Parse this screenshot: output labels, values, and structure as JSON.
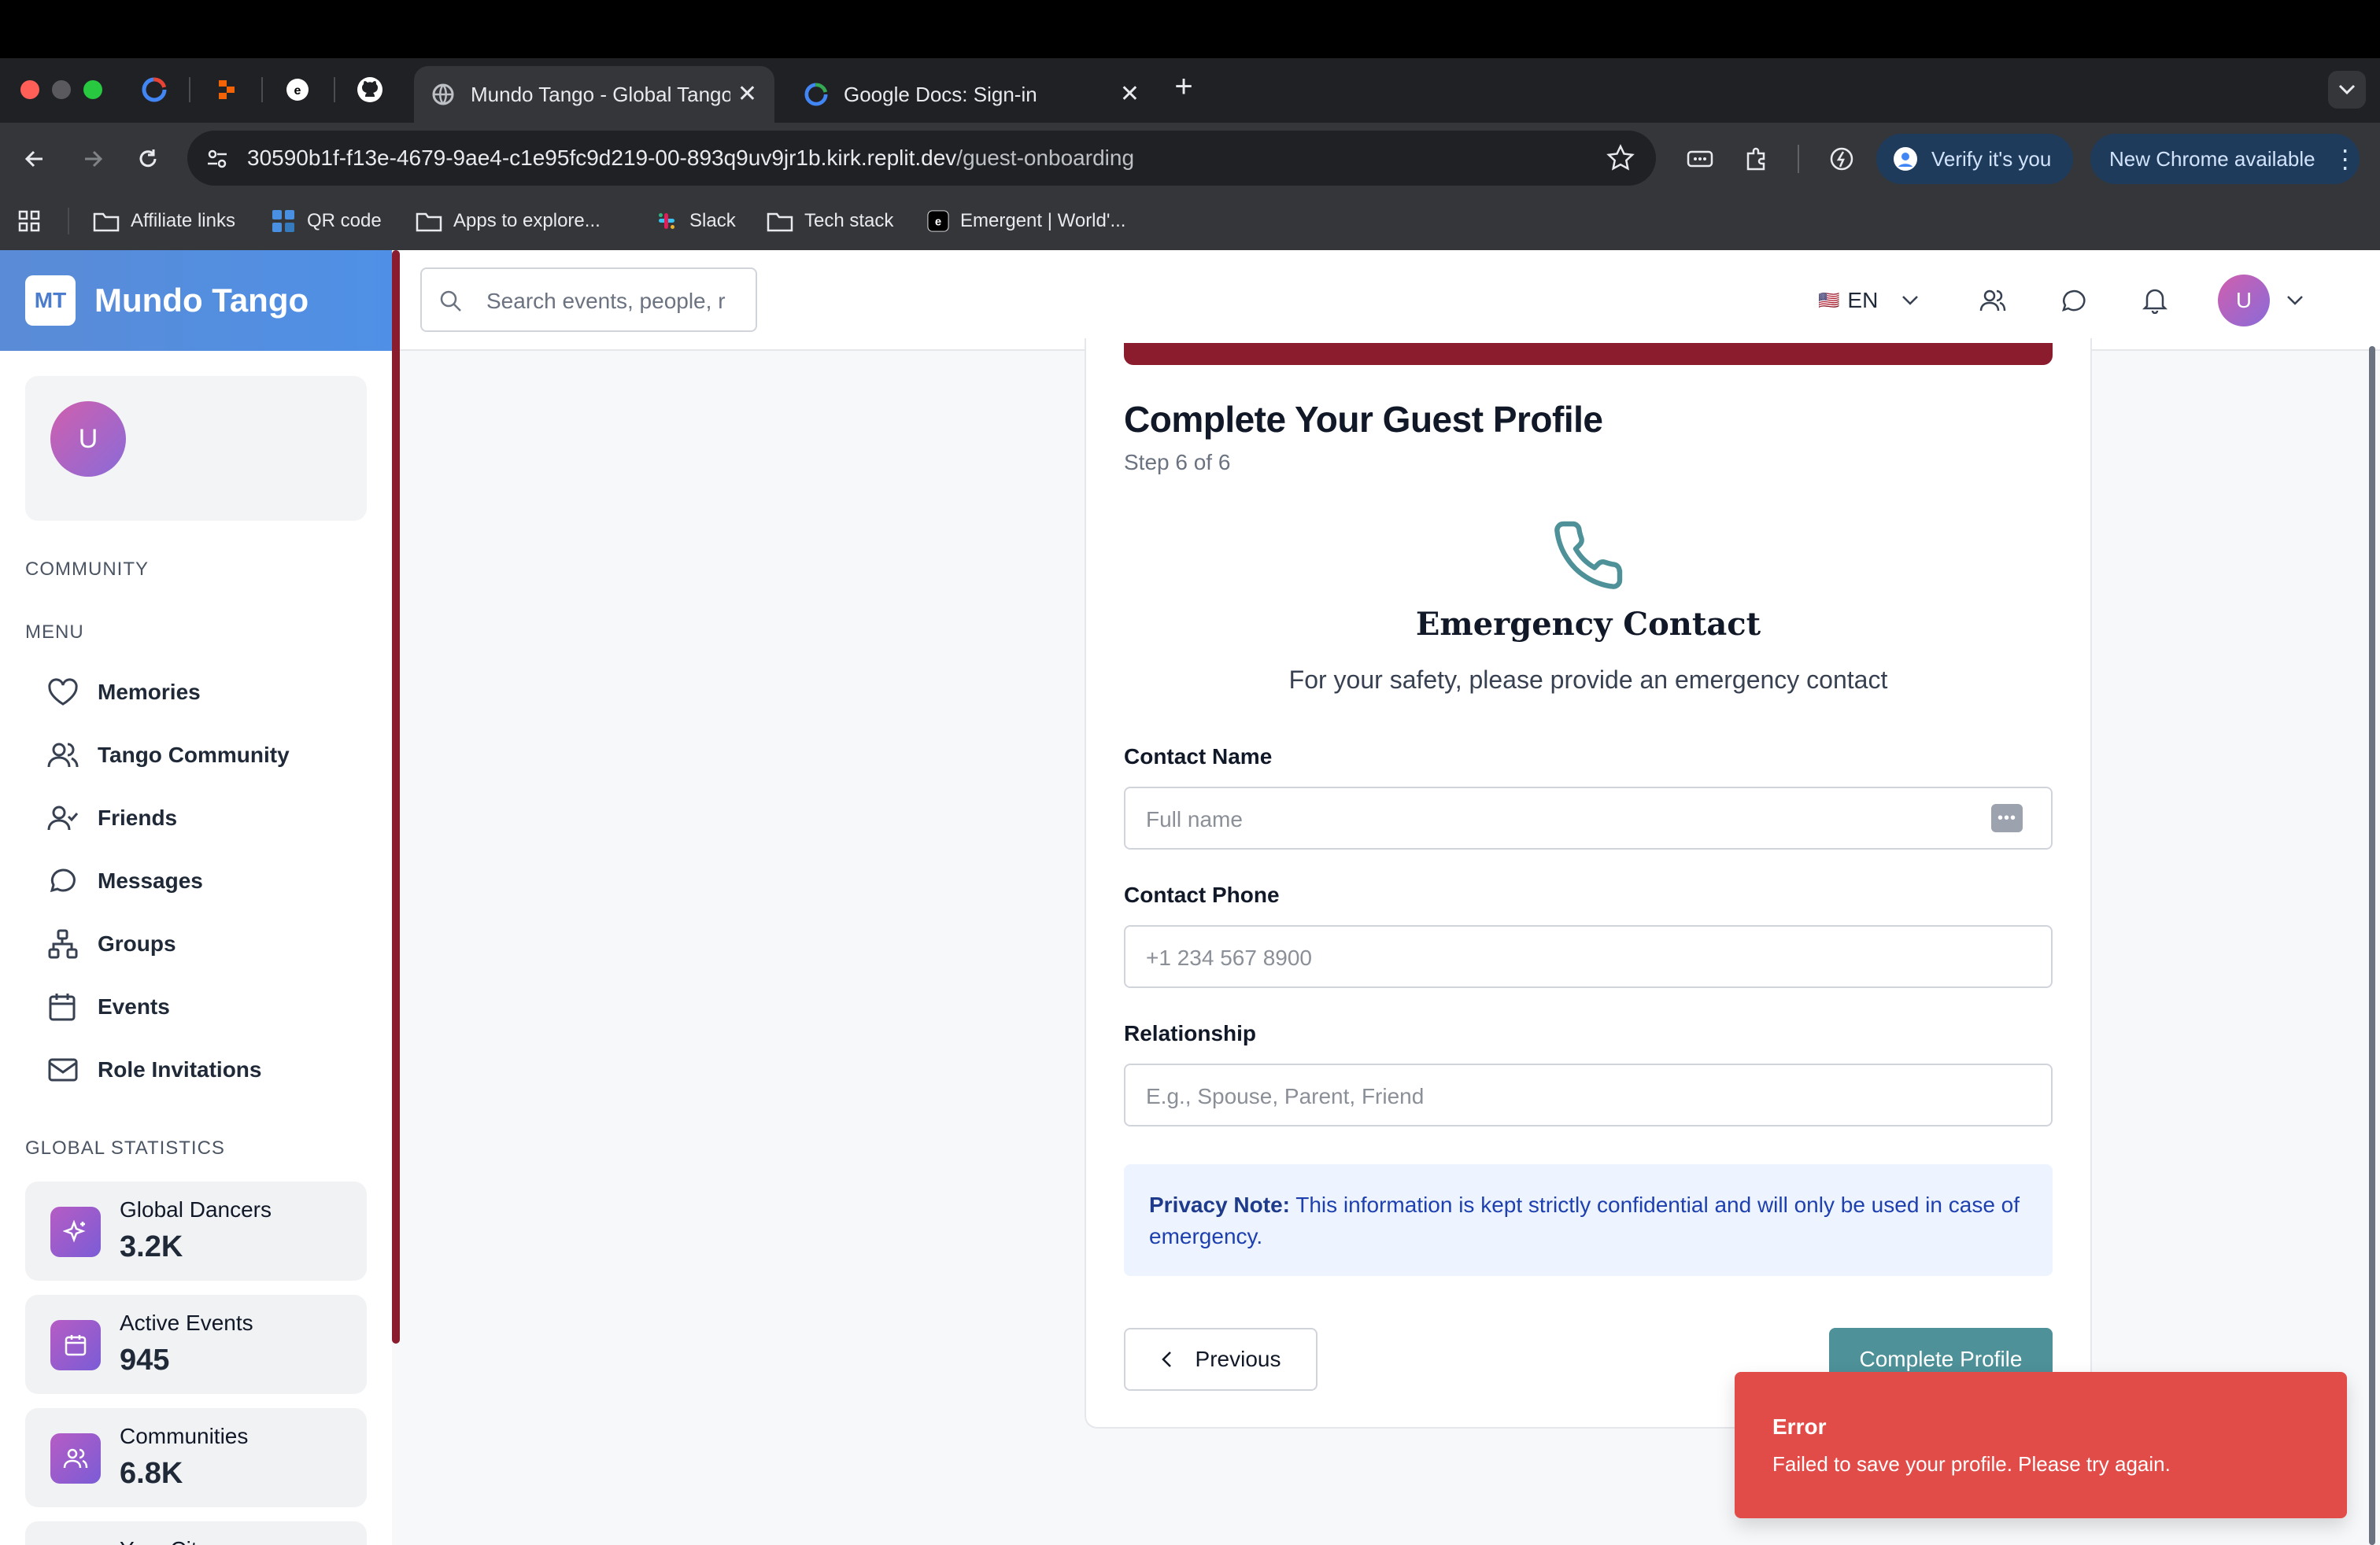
{
  "browser": {
    "tabs": [
      {
        "title": "Mundo Tango - Global Tango",
        "close": "✕"
      },
      {
        "title": "Google Docs: Sign-in",
        "close": "✕"
      }
    ],
    "url_host": "30590b1f-f13e-4679-9ae4-c1e95fc9d219-00-893q9uv9jr1b.kirk.replit.dev",
    "url_path": "/guest-onboarding",
    "verify_label": "Verify it's you",
    "update_label": "New Chrome available",
    "bookmarks": [
      "Affiliate links",
      "QR code",
      "Apps to explore...",
      "Slack",
      "Tech stack",
      "Emergent | World'..."
    ]
  },
  "sidebar": {
    "logo": "MT",
    "brand": "Mundo Tango",
    "user_initial": "U",
    "community_label": "COMMUNITY",
    "menu_label": "MENU",
    "items": [
      "Memories",
      "Tango Community",
      "Friends",
      "Messages",
      "Groups",
      "Events",
      "Role Invitations"
    ],
    "stats_label": "GLOBAL STATISTICS",
    "stats": [
      {
        "label": "Global Dancers",
        "value": "3.2K"
      },
      {
        "label": "Active Events",
        "value": "945"
      },
      {
        "label": "Communities",
        "value": "6.8K"
      },
      {
        "label": "Your City",
        "value": ""
      }
    ]
  },
  "header": {
    "search_placeholder": "Search events, people, r",
    "language": "EN",
    "flag": "🇺🇸",
    "user_initial": "U"
  },
  "form": {
    "title": "Complete Your Guest Profile",
    "step": "Step 6 of 6",
    "section_title": "Emergency Contact",
    "section_sub": "For your safety, please provide an emergency contact",
    "name_label": "Contact Name",
    "name_placeholder": "Full name",
    "phone_label": "Contact Phone",
    "phone_placeholder": "+1 234 567 8900",
    "relationship_label": "Relationship",
    "relationship_placeholder": "E.g., Spouse, Parent, Friend",
    "privacy_bold": "Privacy Note:",
    "privacy_text": " This information is kept strictly confidential and will only be used in case of emergency.",
    "previous_label": "Previous",
    "complete_label": "Complete Profile",
    "progress": 1.0
  },
  "toast": {
    "title": "Error",
    "message": "Failed to save your profile. Please try again."
  },
  "colors": {
    "brand_blue": "#4f90e6",
    "accent_maroon": "#8a1c2d",
    "teal": "#4e9199",
    "error_red": "#e24c48"
  }
}
